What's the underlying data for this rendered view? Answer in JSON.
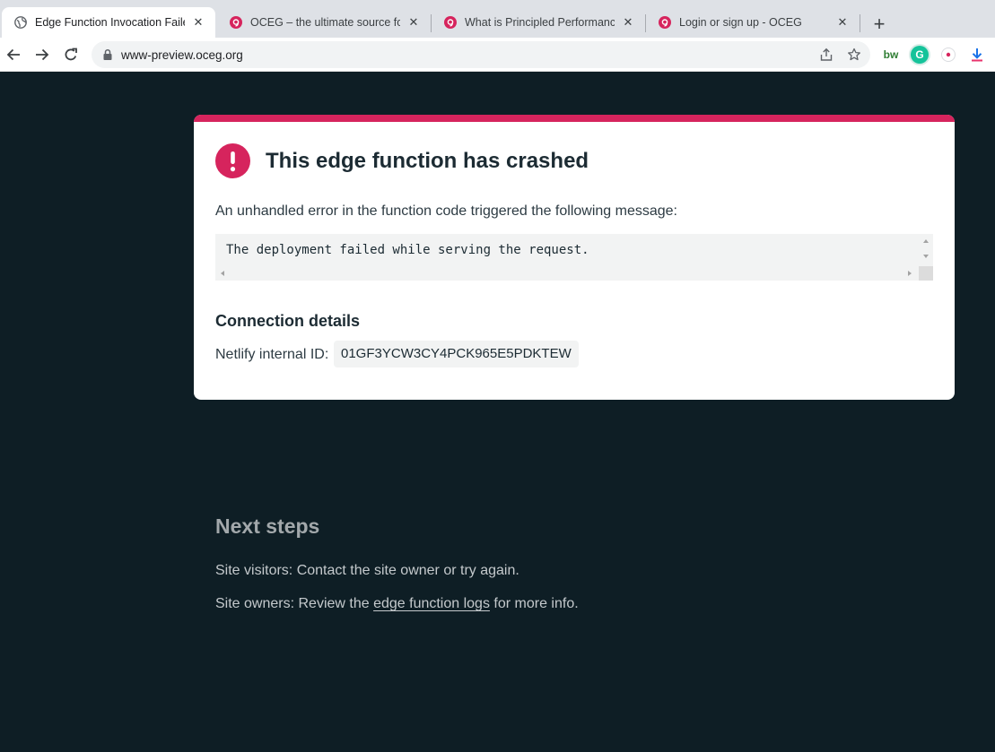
{
  "browser": {
    "tabs": [
      {
        "title": "Edge Function Invocation Failed",
        "active": true,
        "favicon": "globe-icon"
      },
      {
        "title": "OCEG – the ultimate source for G",
        "active": false,
        "favicon": "oceg-logo-icon"
      },
      {
        "title": "What is Principled Performance?",
        "active": false,
        "favicon": "oceg-logo-icon"
      },
      {
        "title": "Login or sign up - OCEG",
        "active": false,
        "favicon": "oceg-logo-icon"
      }
    ],
    "tab_close_glyph": "✕",
    "new_tab_glyph": "+",
    "url": "www-preview.oceg.org",
    "extensions": {
      "bw_label": "bw",
      "grammarly_label": "G"
    },
    "colors": {
      "favicon_red": "#d6245d",
      "grammarly_green": "#15c39a",
      "download_blue": "#1a73e8"
    }
  },
  "error_card": {
    "title": "This edge function has crashed",
    "description": "An unhandled error in the function code triggered the following message:",
    "message": "The deployment failed while serving the request.",
    "connection_heading": "Connection details",
    "internal_id_label": "Netlify internal ID:",
    "internal_id": "01GF3YCW3CY4PCK965E5PDKTEW",
    "accent_color": "#d6245d"
  },
  "next_steps": {
    "heading": "Next steps",
    "visitors_text": "Site visitors: Contact the site owner or try again.",
    "owners_prefix": "Site owners: Review the ",
    "owners_link": "edge function logs",
    "owners_suffix": " for more info."
  }
}
